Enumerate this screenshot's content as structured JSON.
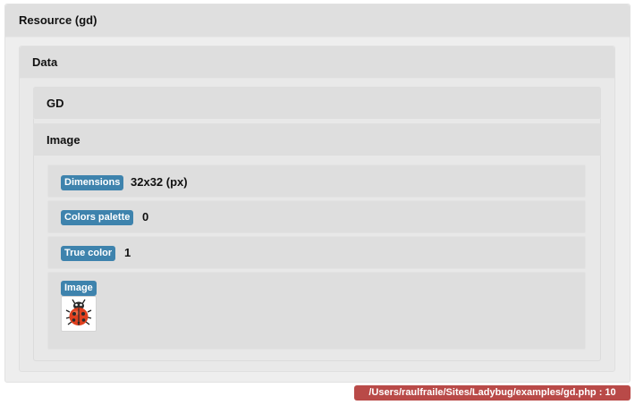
{
  "resource": {
    "title": "Resource (gd)"
  },
  "data": {
    "title": "Data"
  },
  "gd": {
    "title": "GD"
  },
  "image_section": {
    "title": "Image"
  },
  "properties": [
    {
      "label": "Dimensions",
      "value": "32x32 (px)"
    },
    {
      "label": "Colors palette",
      "value": "0"
    },
    {
      "label": "True color",
      "value": "1"
    }
  ],
  "image_property": {
    "label": "Image",
    "thumbnail_icon": "ladybug-icon"
  },
  "footer": {
    "path": "/Users/raulfraile/Sites/Ladybug/examples/gd.php : 10",
    "color": "#b94a48"
  },
  "colors": {
    "badge": "#3e83ad",
    "panel_header": "#dfdfdf",
    "panel_body": "#eeeeee"
  }
}
